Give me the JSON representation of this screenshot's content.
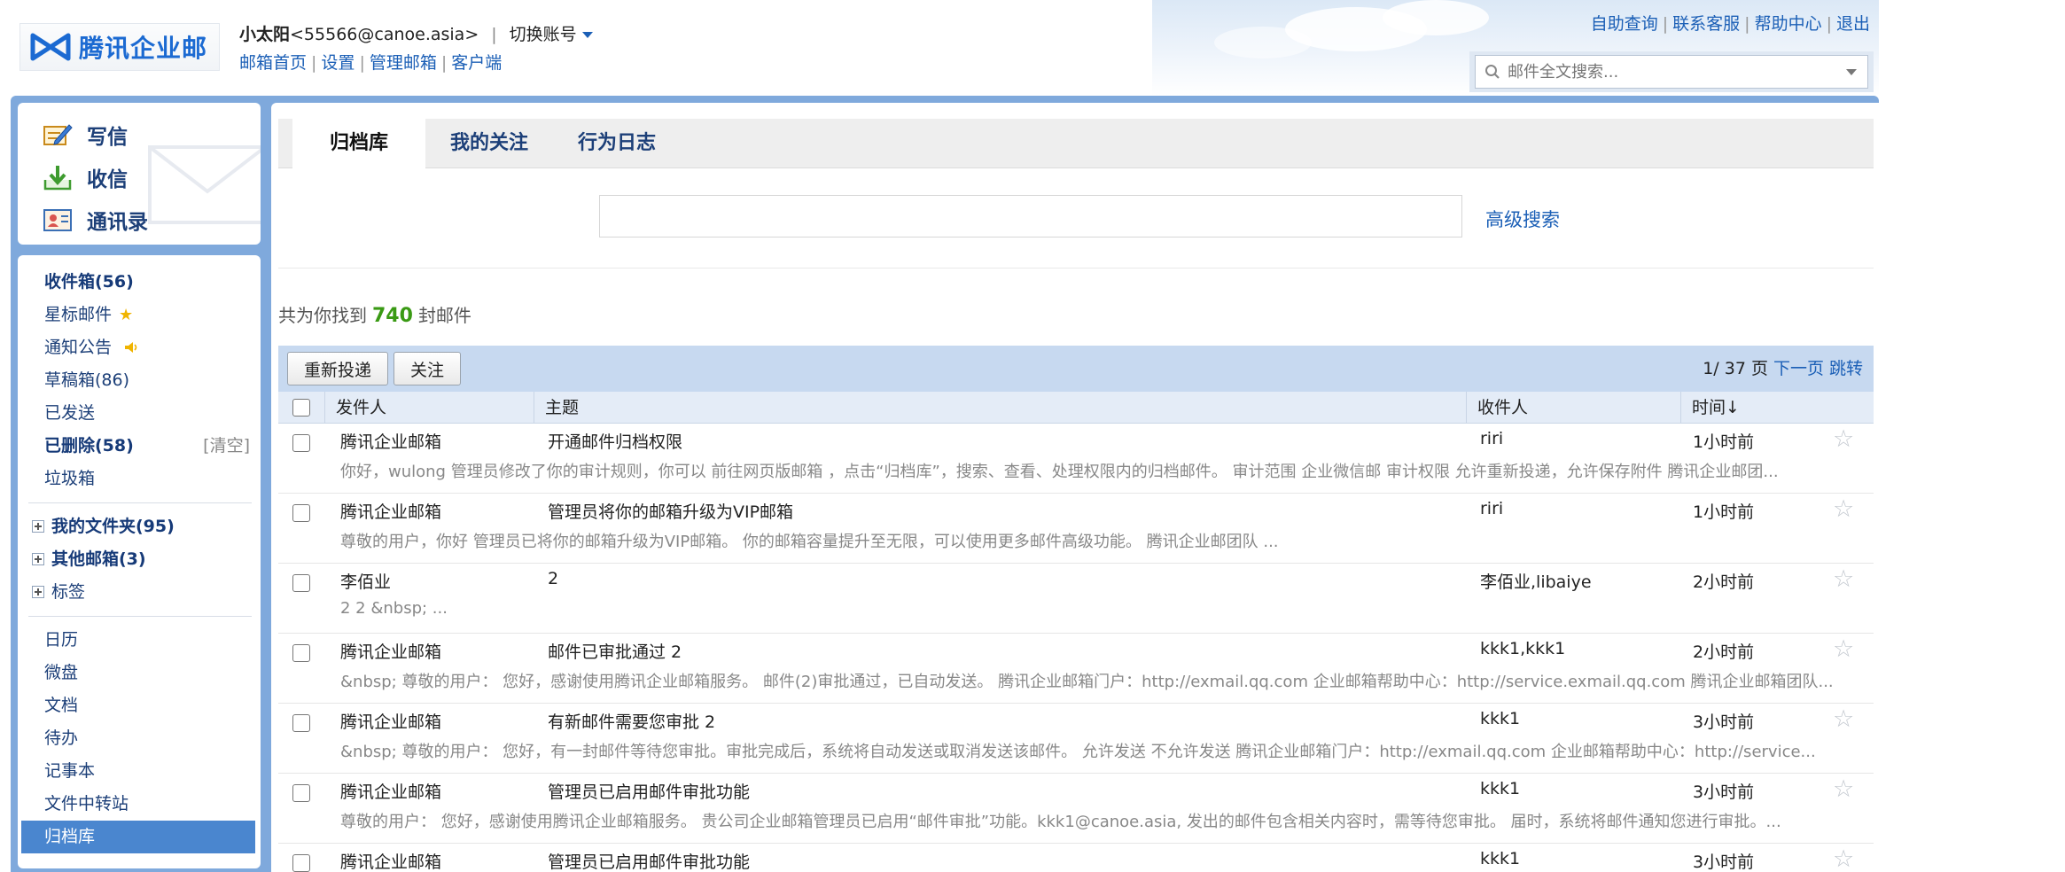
{
  "header": {
    "logo_text": "腾讯企业邮",
    "user_name": "小太阳",
    "user_email": "<55566@canoe.asia>",
    "switch_account": "切换账号",
    "nav": [
      "邮箱首页",
      "设置",
      "管理邮箱",
      "客户端"
    ],
    "top_links": [
      "自助查询",
      "联系客服",
      "帮助中心",
      "退出"
    ],
    "search_placeholder": "邮件全文搜索..."
  },
  "sidebar": {
    "quick": [
      "写信",
      "收信",
      "通讯录"
    ],
    "folders": {
      "inbox": "收件箱(56)",
      "starred": "星标邮件",
      "notice": "通知公告",
      "drafts": "草稿箱(86)",
      "sent": "已发送",
      "deleted": "已删除(58)",
      "clear": "[清空]",
      "spam": "垃圾箱"
    },
    "trees": [
      "我的文件夹(95)",
      "其他邮箱(3)",
      "标签"
    ],
    "apps": [
      "日历",
      "微盘",
      "文档",
      "待办",
      "记事本",
      "文件中转站",
      "归档库"
    ]
  },
  "main": {
    "tabs": [
      "归档库",
      "我的关注",
      "行为日志"
    ],
    "advanced_search": "高级搜索",
    "found_prefix": "共为你找到",
    "found_count": "740",
    "found_suffix": "封邮件",
    "buttons": {
      "resend": "重新投递",
      "follow": "关注"
    },
    "pager": {
      "info": "1/ 37 页",
      "next": "下一页",
      "jump": "跳转"
    },
    "columns": {
      "sender": "发件人",
      "subject": "主题",
      "recipient": "收件人",
      "time": "时间↓"
    },
    "rows": [
      {
        "sender": "腾讯企业邮箱",
        "subject": "开通邮件归档权限",
        "recipient": "riri",
        "time": "1小时前",
        "preview": "你好，wulong 管理员修改了你的审计规则，你可以 前往网页版邮箱 ，点击“归档库”，搜索、查看、处理权限内的归档邮件。 审计范围 企业微信邮 审计权限 允许重新投递，允许保存附件 腾讯企业邮团..."
      },
      {
        "sender": "腾讯企业邮箱",
        "subject": "管理员将你的邮箱升级为VIP邮箱",
        "recipient": "riri",
        "time": "1小时前",
        "preview": "尊敬的用户，你好 管理员已将你的邮箱升级为VIP邮箱。 你的邮箱容量提升至无限，可以使用更多邮件高级功能。 腾讯企业邮团队  ..."
      },
      {
        "sender": "李佰业",
        "subject": "2",
        "recipient": "李佰业,libaiye",
        "time": "2小时前",
        "preview": "2 2 &nbsp;  ..."
      },
      {
        "sender": "腾讯企业邮箱",
        "subject": "邮件已审批通过 2",
        "recipient": "kkk1,kkk1",
        "time": "2小时前",
        "preview": "&nbsp; 尊敬的用户：  您好，感谢使用腾讯企业邮箱服务。 邮件(2)审批通过，已自动发送。 腾讯企业邮箱门户：http://exmail.qq.com 企业邮箱帮助中心：http://service.exmail.qq.com 腾讯企业邮箱团队..."
      },
      {
        "sender": "腾讯企业邮箱",
        "subject": "有新邮件需要您审批 2",
        "recipient": "kkk1",
        "time": "3小时前",
        "preview": "&nbsp; 尊敬的用户：  您好，有一封邮件等待您审批。审批完成后，系统将自动发送或取消发送该邮件。 允许发送 不允许发送 腾讯企业邮箱门户：http://exmail.qq.com 企业邮箱帮助中心：http://service..."
      },
      {
        "sender": "腾讯企业邮箱",
        "subject": "管理员已启用邮件审批功能",
        "recipient": "kkk1",
        "time": "3小时前",
        "preview": "尊敬的用户：  您好，感谢使用腾讯企业邮箱服务。 贵公司企业邮箱管理员已启用“邮件审批”功能。kkk1@canoe.asia, 发出的邮件包含相关内容时，需等待您审批。 届时，系统将邮件通知您进行审批。..."
      },
      {
        "sender": "腾讯企业邮箱",
        "subject": "管理员已启用邮件审批功能",
        "recipient": "kkk1",
        "time": "3小时前",
        "preview": ""
      }
    ]
  },
  "colors": {
    "brand": "#1b6ad2",
    "frame": "#7fa9dc",
    "link": "#1b5fb6",
    "active": "#4a86cf",
    "count": "#3a9a14"
  }
}
